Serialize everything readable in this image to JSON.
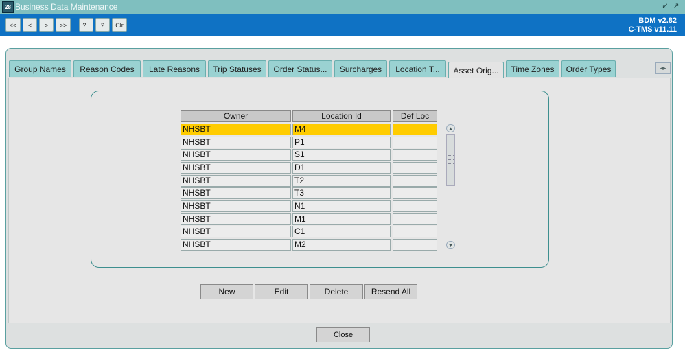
{
  "window": {
    "title": "Business Data Maintenance",
    "app_icon": "app-icon",
    "controls": [
      "minimize-icon",
      "maximize-icon"
    ]
  },
  "toolbar": {
    "buttons": [
      {
        "label": "<<",
        "name": "first-record-button"
      },
      {
        "label": "<",
        "name": "previous-record-button"
      },
      {
        "label": ">",
        "name": "next-record-button"
      },
      {
        "label": ">>",
        "name": "last-record-button"
      },
      {
        "label": "?..",
        "name": "query-entry-button"
      },
      {
        "label": "?",
        "name": "query-execute-button"
      },
      {
        "label": "Clr",
        "name": "clear-button"
      }
    ],
    "version_line1": "BDM v2.82",
    "version_line2": "C-TMS v11.11"
  },
  "tabs": [
    {
      "label": "Group Names",
      "active": false
    },
    {
      "label": "Reason Codes",
      "active": false
    },
    {
      "label": "Late Reasons",
      "active": false
    },
    {
      "label": "Trip Statuses",
      "active": false
    },
    {
      "label": "Order Status...",
      "active": false
    },
    {
      "label": "Surcharges",
      "active": false
    },
    {
      "label": "Location T...",
      "active": false
    },
    {
      "label": "Asset Orig...",
      "active": true
    },
    {
      "label": "Time Zones",
      "active": false
    },
    {
      "label": "Order Types",
      "active": false
    }
  ],
  "tab_scroll_icon": "tab-scroll-arrows-icon",
  "table": {
    "columns": [
      "Owner",
      "Location Id",
      "Def Loc"
    ],
    "rows": [
      {
        "owner": "NHSBT",
        "location_id": "M4",
        "def_loc": "",
        "selected": true
      },
      {
        "owner": "NHSBT",
        "location_id": "P1",
        "def_loc": "",
        "selected": false
      },
      {
        "owner": "NHSBT",
        "location_id": "S1",
        "def_loc": "",
        "selected": false
      },
      {
        "owner": "NHSBT",
        "location_id": "D1",
        "def_loc": "",
        "selected": false
      },
      {
        "owner": "NHSBT",
        "location_id": "T2",
        "def_loc": "",
        "selected": false
      },
      {
        "owner": "NHSBT",
        "location_id": "T3",
        "def_loc": "",
        "selected": false
      },
      {
        "owner": "NHSBT",
        "location_id": "N1",
        "def_loc": "",
        "selected": false
      },
      {
        "owner": "NHSBT",
        "location_id": "M1",
        "def_loc": "",
        "selected": false
      },
      {
        "owner": "NHSBT",
        "location_id": "C1",
        "def_loc": "",
        "selected": false
      },
      {
        "owner": "NHSBT",
        "location_id": "M2",
        "def_loc": "",
        "selected": false
      }
    ]
  },
  "actions": {
    "new": "New",
    "edit": "Edit",
    "delete": "Delete",
    "resend_all": "Resend All"
  },
  "footer": {
    "close": "Close"
  },
  "colors": {
    "titlebar": "#7fbfbf",
    "toolbar": "#0f72c4",
    "tab": "#9ad2d2",
    "selected_row": "#ffcc00",
    "group_border": "#3e8f8f"
  }
}
